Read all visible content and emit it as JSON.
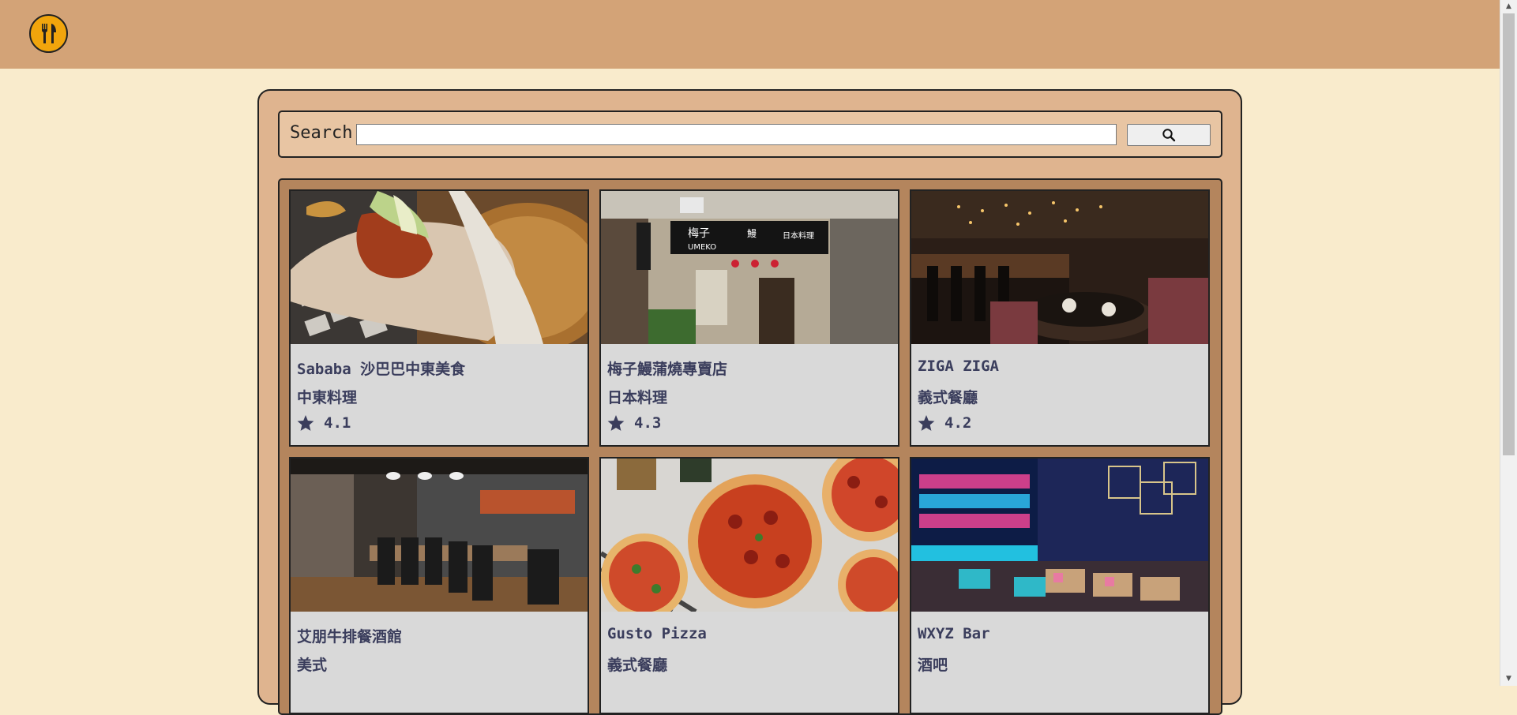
{
  "header": {
    "logo_icon": "fork-knife-icon",
    "logo_color": "#f1a50c",
    "bar_color": "#d3a377"
  },
  "search": {
    "label": "Search",
    "value": "",
    "placeholder": "",
    "button_icon": "search-icon"
  },
  "restaurants": [
    {
      "name": "Sababa 沙巴巴中東美食",
      "cuisine": "中東料理",
      "rating": "4.1",
      "image": "pita-wrap-photo"
    },
    {
      "name": "梅子鰻蒲燒專賣店",
      "cuisine": "日本料理",
      "rating": "4.3",
      "image": "umeko-storefront-photo"
    },
    {
      "name": "ZIGA ZIGA",
      "cuisine": "義式餐廳",
      "rating": "4.2",
      "image": "bar-lounge-photo"
    },
    {
      "name": "艾朋牛排餐酒館",
      "cuisine": "美式",
      "rating": "",
      "image": "private-dining-room-photo"
    },
    {
      "name": "Gusto Pizza",
      "cuisine": "義式餐廳",
      "rating": "",
      "image": "pizzas-photo"
    },
    {
      "name": "WXYZ Bar",
      "cuisine": "酒吧",
      "rating": "",
      "image": "neon-bar-photo"
    }
  ],
  "colors": {
    "background": "#f9ebcc",
    "panel": "#dfb48f",
    "grid": "#b4855d",
    "card": "#d9d9d9",
    "text": "#3a3d5c"
  }
}
